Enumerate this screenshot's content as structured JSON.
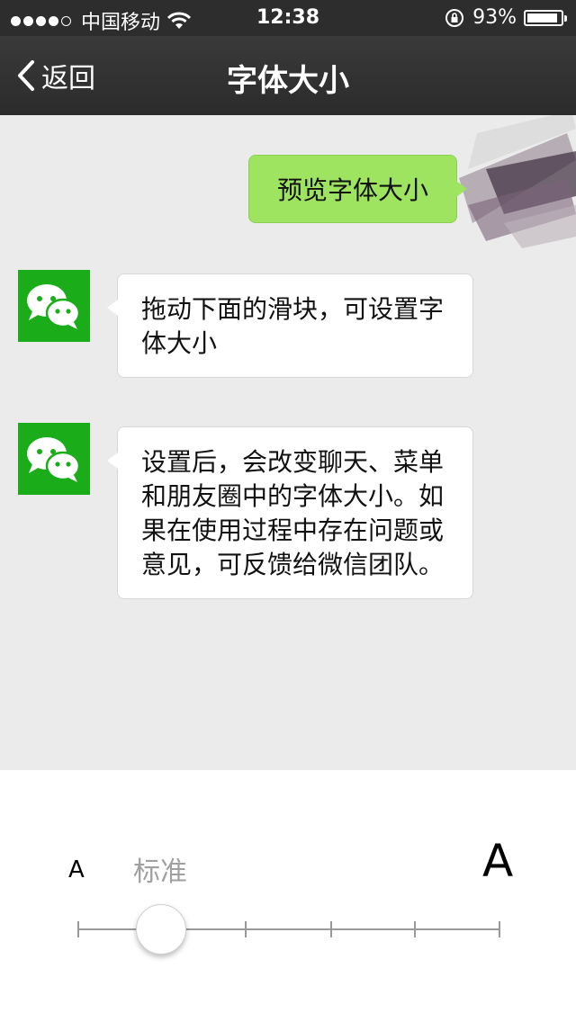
{
  "status_bar": {
    "carrier": "中国移动",
    "time": "12:38",
    "battery_text": "93%",
    "battery_level": 0.93,
    "signal_bars_filled": 4,
    "signal_bars_total": 5
  },
  "nav": {
    "back_label": "返回",
    "title": "字体大小"
  },
  "chat": {
    "outgoing_message": "预览字体大小",
    "incoming_messages": [
      {
        "text": "拖动下面的滑块，可设置字体大小"
      },
      {
        "text": "设置后，会改变聊天、菜单和朋友圈中的字体大小。如果在使用过程中存在问题或意见，可反馈给微信团队。"
      }
    ],
    "avatar_icon": "wechat-logo-icon"
  },
  "font_panel": {
    "small_label": "A",
    "current_size_label": "标准",
    "large_label": "A",
    "slider_steps": 5,
    "slider_value_index": 1
  },
  "colors": {
    "bubble_out": "#9ee461",
    "avatar_green": "#1aad19",
    "navbar": "#2d2d2d",
    "chat_bg": "#ebebeb"
  }
}
